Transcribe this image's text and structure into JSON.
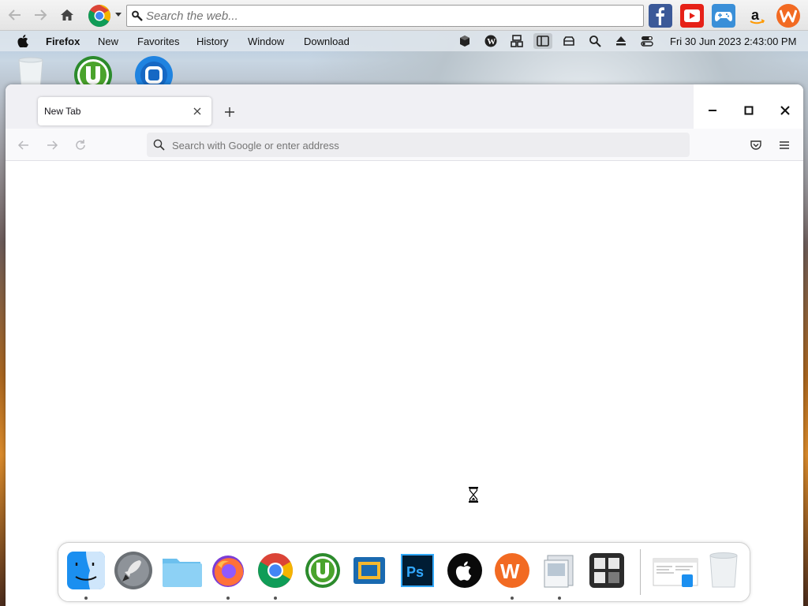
{
  "top_toolbar": {
    "search_placeholder": "Search the web..."
  },
  "menubar": {
    "app_name": "Firefox",
    "items": [
      {
        "label": "New"
      },
      {
        "label": "Favorites"
      },
      {
        "label": "History"
      },
      {
        "label": "Window"
      },
      {
        "label": "Download"
      }
    ],
    "datetime": "Fri 30 Jun 2023 2:43:00 PM"
  },
  "firefox": {
    "tab_title": "New Tab",
    "urlbar_placeholder": "Search with Google or enter address"
  },
  "dock": {
    "apps": [
      {
        "icon": "finder-icon"
      },
      {
        "icon": "launchpad-icon"
      },
      {
        "icon": "folder-icon"
      },
      {
        "icon": "firefox-icon"
      },
      {
        "icon": "chrome-icon"
      },
      {
        "icon": "utorrent-icon"
      },
      {
        "icon": "virtualbox-icon"
      },
      {
        "icon": "photoshop-icon",
        "text": "Ps"
      },
      {
        "icon": "apple-icon"
      },
      {
        "icon": "w-icon",
        "text": "W"
      },
      {
        "icon": "preview-icon"
      },
      {
        "icon": "grid-app-icon"
      }
    ]
  },
  "colors": {
    "facebook": "#3b5998",
    "youtube": "#e62117",
    "firefox_tabstrip": "#f0f0f4",
    "urlbar_bg": "#ededf0",
    "w_orange": "#f26a22"
  }
}
